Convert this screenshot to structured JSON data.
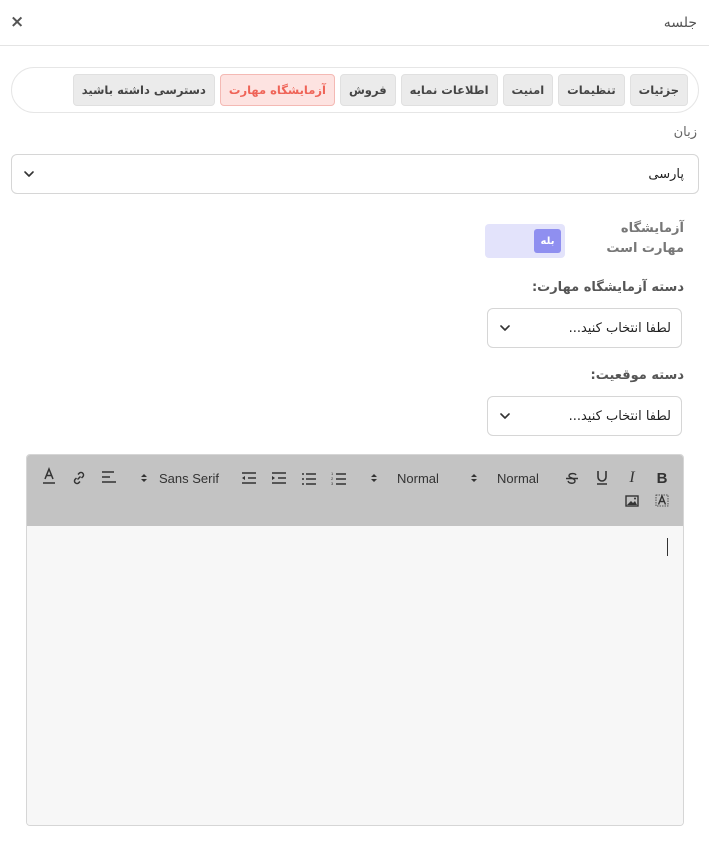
{
  "header": {
    "title": "جلسه",
    "close_symbol": "×"
  },
  "tabs": [
    {
      "label": "جزئیات",
      "active": false
    },
    {
      "label": "تنظیمات",
      "active": false
    },
    {
      "label": "امنیت",
      "active": false
    },
    {
      "label": "اطلاعات نمایه",
      "active": false
    },
    {
      "label": "فروش",
      "active": false
    },
    {
      "label": "آزمایشگاه مهارت",
      "active": true
    },
    {
      "label": "دسترسی داشته باشید",
      "active": false
    }
  ],
  "language": {
    "label": "زبان",
    "value": "پارسی"
  },
  "skill_lab": {
    "label": "آزمایشگاه مهارت است",
    "toggle_value": "بله"
  },
  "skill_category": {
    "label": "دسته آزمایشگاه مهارت:",
    "value": "لطفا انتخاب کنید..."
  },
  "position_category": {
    "label": "دسته موقعیت:",
    "value": "لطفا انتخاب کنید..."
  },
  "editor": {
    "header_select": "Normal",
    "size_select": "Normal",
    "font_select": "Sans Serif"
  },
  "colors": {
    "active_tab_bg": "#fde3e1",
    "active_tab_text": "#ef6357",
    "toggle_bg": "#e3e3fb",
    "toggle_knob": "#8f8ff0",
    "toolbar_bg": "#c3c3c3"
  }
}
